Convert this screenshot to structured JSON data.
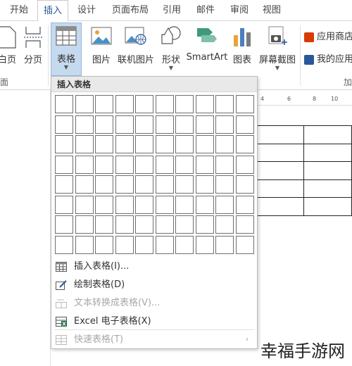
{
  "menu_tabs": [
    {
      "label": "开始"
    },
    {
      "label": "插入"
    },
    {
      "label": "设计"
    },
    {
      "label": "页面布局"
    },
    {
      "label": "引用"
    },
    {
      "label": "邮件"
    },
    {
      "label": "审阅"
    },
    {
      "label": "视图"
    }
  ],
  "active_tab": "插入",
  "ribbon": {
    "pages_group": {
      "blank_page_label": "白页",
      "page_break_label": "分页",
      "group_label": "面"
    },
    "table_button_label": "表格",
    "picture_label": "图片",
    "online_picture_label": "联机图片",
    "shapes_label": "形状",
    "smartart_label": "SmartArt",
    "chart_label": "图表",
    "screenshot_label": "屏幕截图",
    "store_label": "应用商店",
    "my_apps_label": "我的应用",
    "addins_group_label": "加"
  },
  "dropdown": {
    "header": "插入表格",
    "grid_columns": 10,
    "grid_rows": 8,
    "items": [
      {
        "label": "插入表格(I)...",
        "icon": "insert-table-icon",
        "enabled": true
      },
      {
        "label": "绘制表格(D)",
        "icon": "draw-table-icon",
        "enabled": true
      },
      {
        "label": "文本转换成表格(V)...",
        "icon": "text-to-table-icon",
        "enabled": false
      },
      {
        "label": "Excel 电子表格(X)",
        "icon": "excel-sheet-icon",
        "enabled": true
      },
      {
        "label": "快速表格(T)",
        "icon": "quick-tables-icon",
        "enabled": false,
        "submenu": true
      }
    ]
  },
  "ruler": {
    "ticks": [
      "4",
      "6",
      "8",
      "10"
    ]
  },
  "watermark": "幸福手游网",
  "colors": {
    "accent": "#2b579a",
    "pressed": "#c5d9ef",
    "excel_green": "#217346"
  }
}
